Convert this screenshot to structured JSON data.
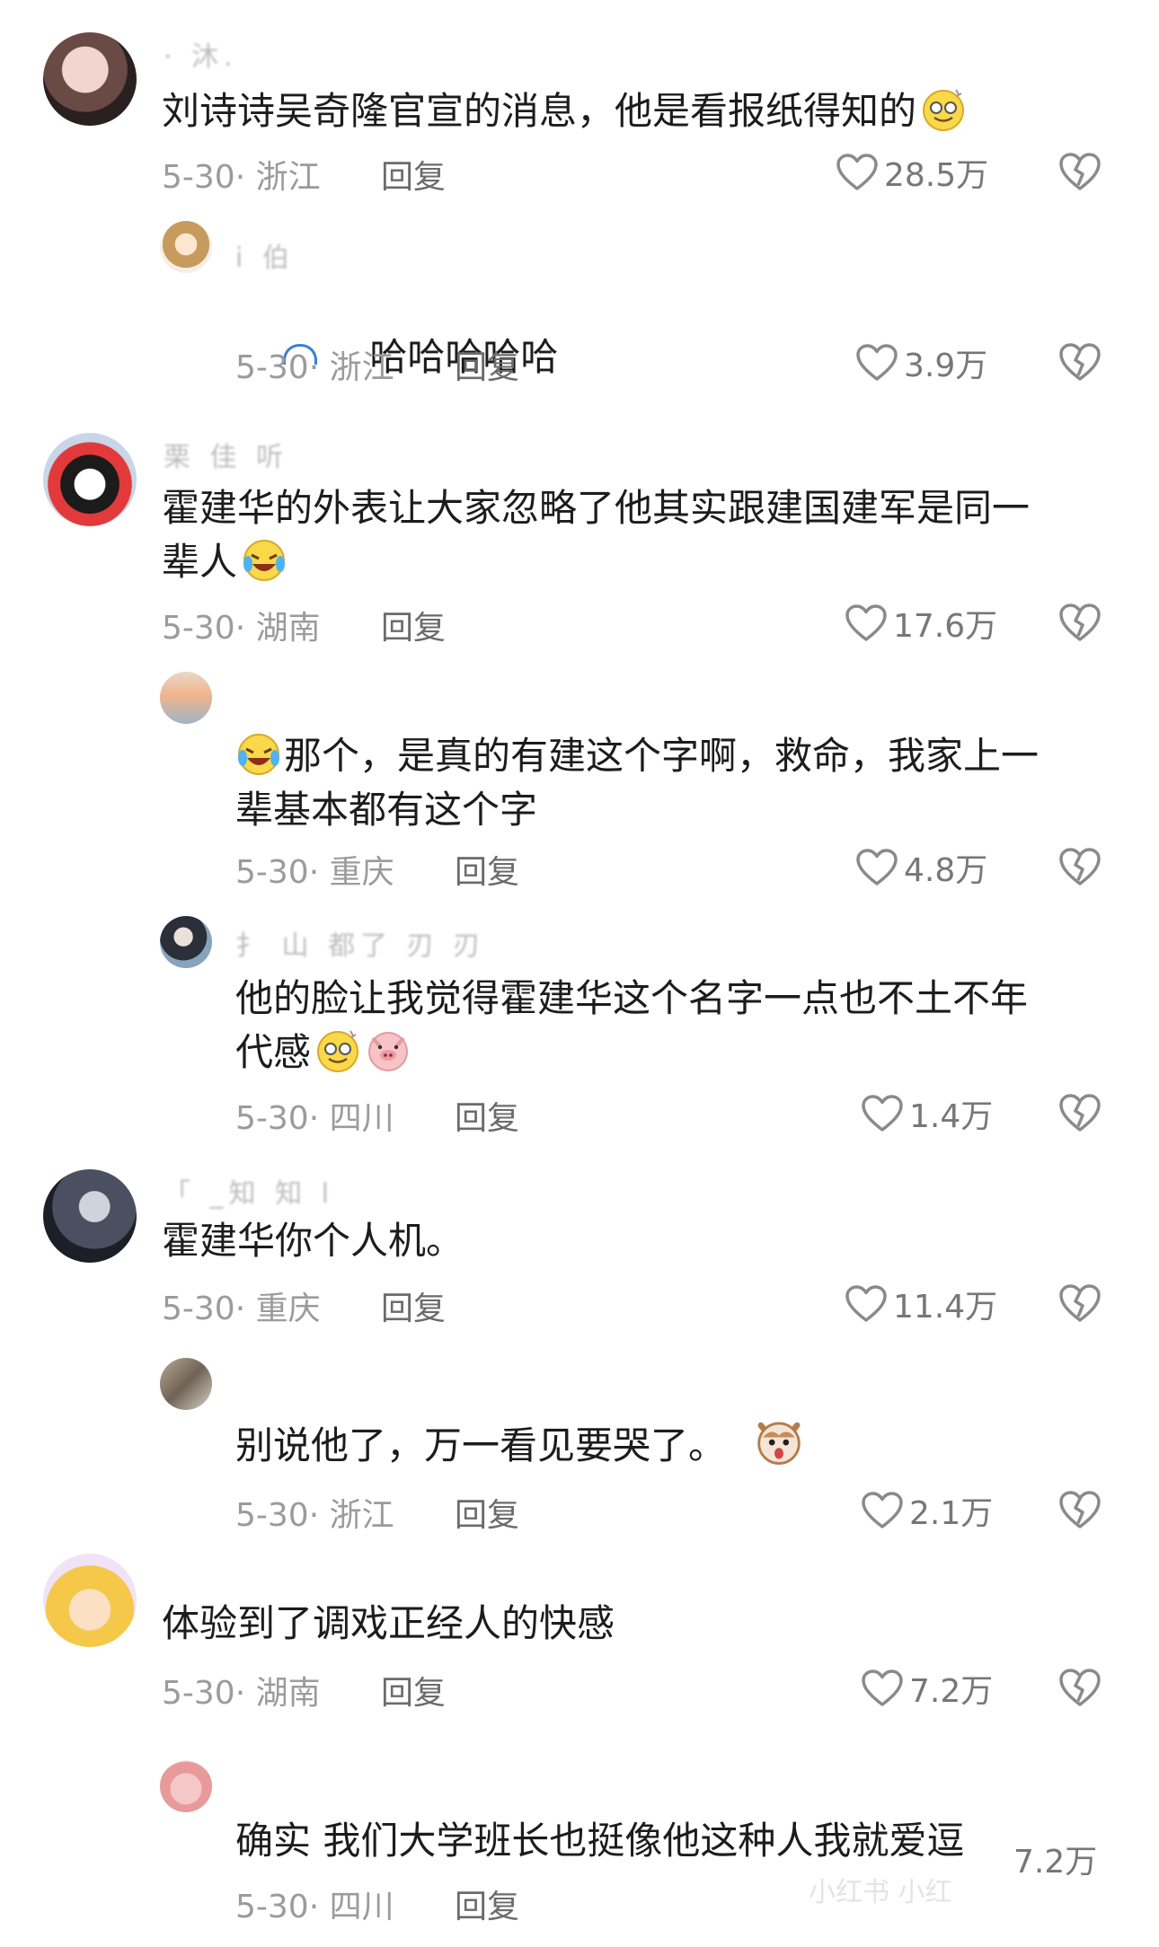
{
  "comments": [
    {
      "username": "· 沐.",
      "text": "刘诗诗吴奇隆官宣的消息，他是看报纸得知的",
      "emoji": "dizzy-smile-emoji",
      "date_location": "5-30· 浙江",
      "reply_label": "回复",
      "likes": "28.5万"
    },
    {
      "username": "i 伯",
      "text": "哈哈哈哈哈",
      "date_location": "5-30· 浙江",
      "reply_label": "回复",
      "likes": "3.9万"
    },
    {
      "username": "栗 佳   听",
      "text": "霍建华的外表让大家忽略了他其实跟建国建军是同一\n辈人",
      "emoji": "laugh-cry-emoji",
      "date_location": "5-30· 湖南",
      "reply_label": "回复",
      "likes": "17.6万"
    },
    {
      "username": "",
      "text": "那个，是真的有建这个字啊，救命，我家上一\n辈基本都有这个字",
      "emoji": "laugh-cry-emoji",
      "date_location": "5-30· 重庆",
      "reply_label": "回复",
      "likes": "4.8万"
    },
    {
      "username": "扌 山 都了  刃 刃",
      "text": "他的脸让我觉得霍建华这个名字一点也不土不年\n代感",
      "emoji": "dizzy-smile-emoji",
      "emoji2": "pig-emoji",
      "date_location": "5-30· 四川",
      "reply_label": "回复",
      "likes": "1.4万"
    },
    {
      "username": "「 _知 知 l",
      "text": "霍建华你个人机。",
      "date_location": "5-30· 重庆",
      "reply_label": "回复",
      "likes": "11.4万"
    },
    {
      "username": "",
      "text": "别说他了，万一看见要哭了。",
      "emoji": "shocked-dog-emoji",
      "date_location": "5-30· 浙江",
      "reply_label": "回复",
      "likes": "2.1万"
    },
    {
      "username": "",
      "text": "体验到了调戏正经人的快感",
      "date_location": "5-30· 湖南",
      "reply_label": "回复",
      "likes": "7.2万"
    },
    {
      "username": "",
      "text": "确实 我们大学班长也挺像他这种人我就爱逗",
      "date_location": "5-30· 四川",
      "reply_label": "回复",
      "likes": "7.2万"
    }
  ],
  "watermark": "小红书 小红",
  "icons": {
    "like": "heart-outline-icon",
    "dislike": "broken-heart-icon"
  },
  "colors": {
    "text": "#1c1c1c",
    "meta": "#9b9b9b",
    "icon": "#8a8a8a"
  }
}
